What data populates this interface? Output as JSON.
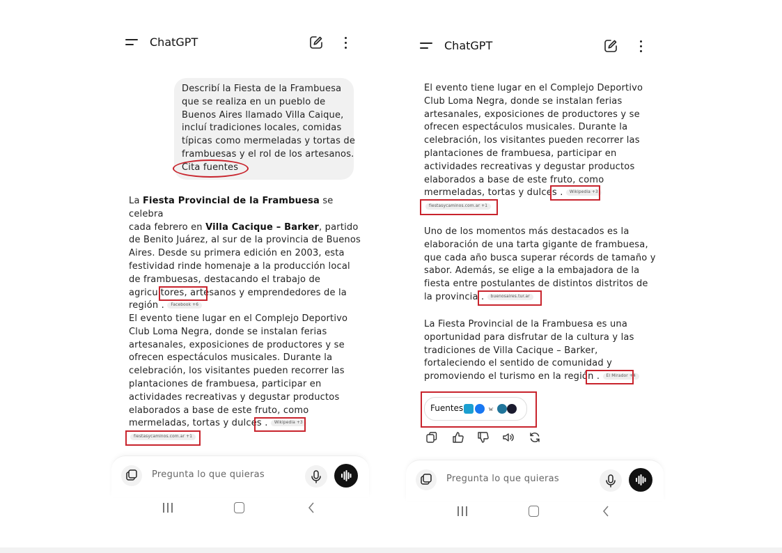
{
  "colors": {
    "annotation_red": "#c8232c",
    "bubble_bg": "#f1f1f1",
    "text": "#222222"
  },
  "left": {
    "title": "ChatGPT",
    "user_message": [
      "Describí la Fiesta de la Frambuesa",
      "que se realiza en un pueblo de",
      "Buenos Aires llamado Villa Caique,",
      "incluí tradiciones locales, comidas",
      "típicas como mermeladas y tortas de",
      "frambuesas y el rol de los artesanos.",
      "Cita fuentes"
    ],
    "para1": {
      "line1_pre": "La ",
      "line1_bold": "Fiesta Provincial de la Frambuesa",
      "line1_post": " se celebra",
      "line2_pre": "cada febrero en ",
      "line2_bold": "Villa Cacique – Barker",
      "line2_post": ", partido",
      "lines": [
        "de Benito Juárez, al sur de la provincia de Buenos",
        "Aires.  Desde su primera edición en 2003, esta",
        "festividad rinde homenaje a la producción local",
        "de frambuesas, destacando el trabajo de",
        "agricultores, artesanos y emprendedores de la"
      ],
      "last_line": "región",
      "citation": "Facebook +6"
    },
    "para2": {
      "lines": [
        "El evento tiene lugar en el Complejo Deportivo",
        "Club Loma Negra, donde se instalan ferias",
        "artesanales, exposiciones de productores y se",
        "ofrecen espectáculos musicales.  Durante la",
        "celebración, los visitantes pueden recorrer las",
        "plantaciones de frambuesa, participar en",
        "actividades recreativas y degustar productos",
        "elaborados a base de este fruto, como"
      ],
      "last_line": "mermeladas, tortas y dulces",
      "citation": "Wikipedia +3",
      "citation2": "fiestasycaminos.com.ar +1"
    },
    "composer": {
      "placeholder": "Pregunta lo que quieras"
    }
  },
  "right": {
    "title": "ChatGPT",
    "para1": {
      "lines": [
        "El evento tiene lugar en el Complejo Deportivo",
        "Club Loma Negra, donde se instalan ferias",
        "artesanales, exposiciones de productores y se",
        "ofrecen espectáculos musicales.  Durante la",
        "celebración, los visitantes pueden recorrer las",
        "plantaciones de frambuesa, participar en",
        "actividades recreativas y degustar productos",
        "elaborados a base de este fruto, como"
      ],
      "last_line": "mermeladas, tortas y dulces",
      "citation": "Wikipedia +3",
      "citation2": "fiestasycaminos.com.ar +1"
    },
    "para2": {
      "lines": [
        "Uno de los momentos más destacados es la",
        "elaboración de una tarta gigante de frambuesa,",
        "que cada año busca superar récords de tamaño y",
        "sabor.  Además, se elige a la embajadora de la",
        "fiesta entre postulantes de distintos distritos de"
      ],
      "last_line": "la provincia",
      "citation": "buenosaires.tur.ar"
    },
    "para3": {
      "lines": [
        "La Fiesta Provincial de la Frambuesa es una",
        "oportunidad para disfrutar de la cultura y las",
        "tradiciones de Villa Cacique – Barker,",
        "fortaleciendo el sentido de comunidad y"
      ],
      "last_line": "promoviendo el turismo en la región",
      "citation": "El Mirador +4"
    },
    "sources": {
      "label": "Fuentes",
      "favicons": [
        "p-icon",
        "facebook-icon",
        "w-icon",
        "wordpress-icon",
        "b-icon"
      ]
    },
    "composer": {
      "placeholder": "Pregunta lo que quieras"
    }
  }
}
